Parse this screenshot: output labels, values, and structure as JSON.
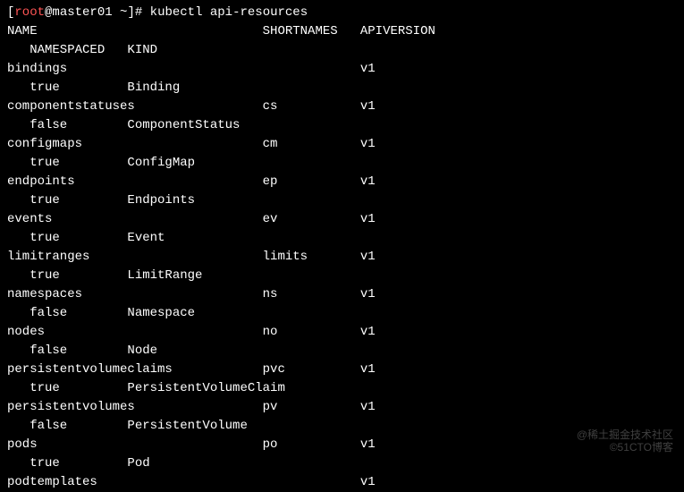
{
  "prompt": {
    "open_bracket": "[",
    "user": "root",
    "at": "@",
    "host": "master01",
    "space": " ",
    "cwd": "~",
    "close_bracket": "]",
    "hash": "# ",
    "command": "kubectl api-resources"
  },
  "headers": {
    "line1": "NAME                              SHORTNAMES   APIVERSION",
    "line2": "   NAMESPACED   KIND"
  },
  "rows": [
    {
      "l1": "bindings                                       v1",
      "l2": "   true         Binding"
    },
    {
      "l1": "componentstatuses                 cs           v1",
      "l2": "   false        ComponentStatus"
    },
    {
      "l1": "configmaps                        cm           v1",
      "l2": "   true         ConfigMap"
    },
    {
      "l1": "endpoints                         ep           v1",
      "l2": "   true         Endpoints"
    },
    {
      "l1": "events                            ev           v1",
      "l2": "   true         Event"
    },
    {
      "l1": "limitranges                       limits       v1",
      "l2": "   true         LimitRange"
    },
    {
      "l1": "namespaces                        ns           v1",
      "l2": "   false        Namespace"
    },
    {
      "l1": "nodes                             no           v1",
      "l2": "   false        Node"
    },
    {
      "l1": "persistentvolumeclaims            pvc          v1",
      "l2": "   true         PersistentVolumeClaim"
    },
    {
      "l1": "persistentvolumes                 pv           v1",
      "l2": "   false        PersistentVolume"
    },
    {
      "l1": "pods                              po           v1",
      "l2": "   true         Pod"
    },
    {
      "l1": "podtemplates                                   v1",
      "l2": ""
    }
  ],
  "watermarks": {
    "w1": "@稀土掘金技术社区",
    "w2": "©51CTO博客"
  }
}
